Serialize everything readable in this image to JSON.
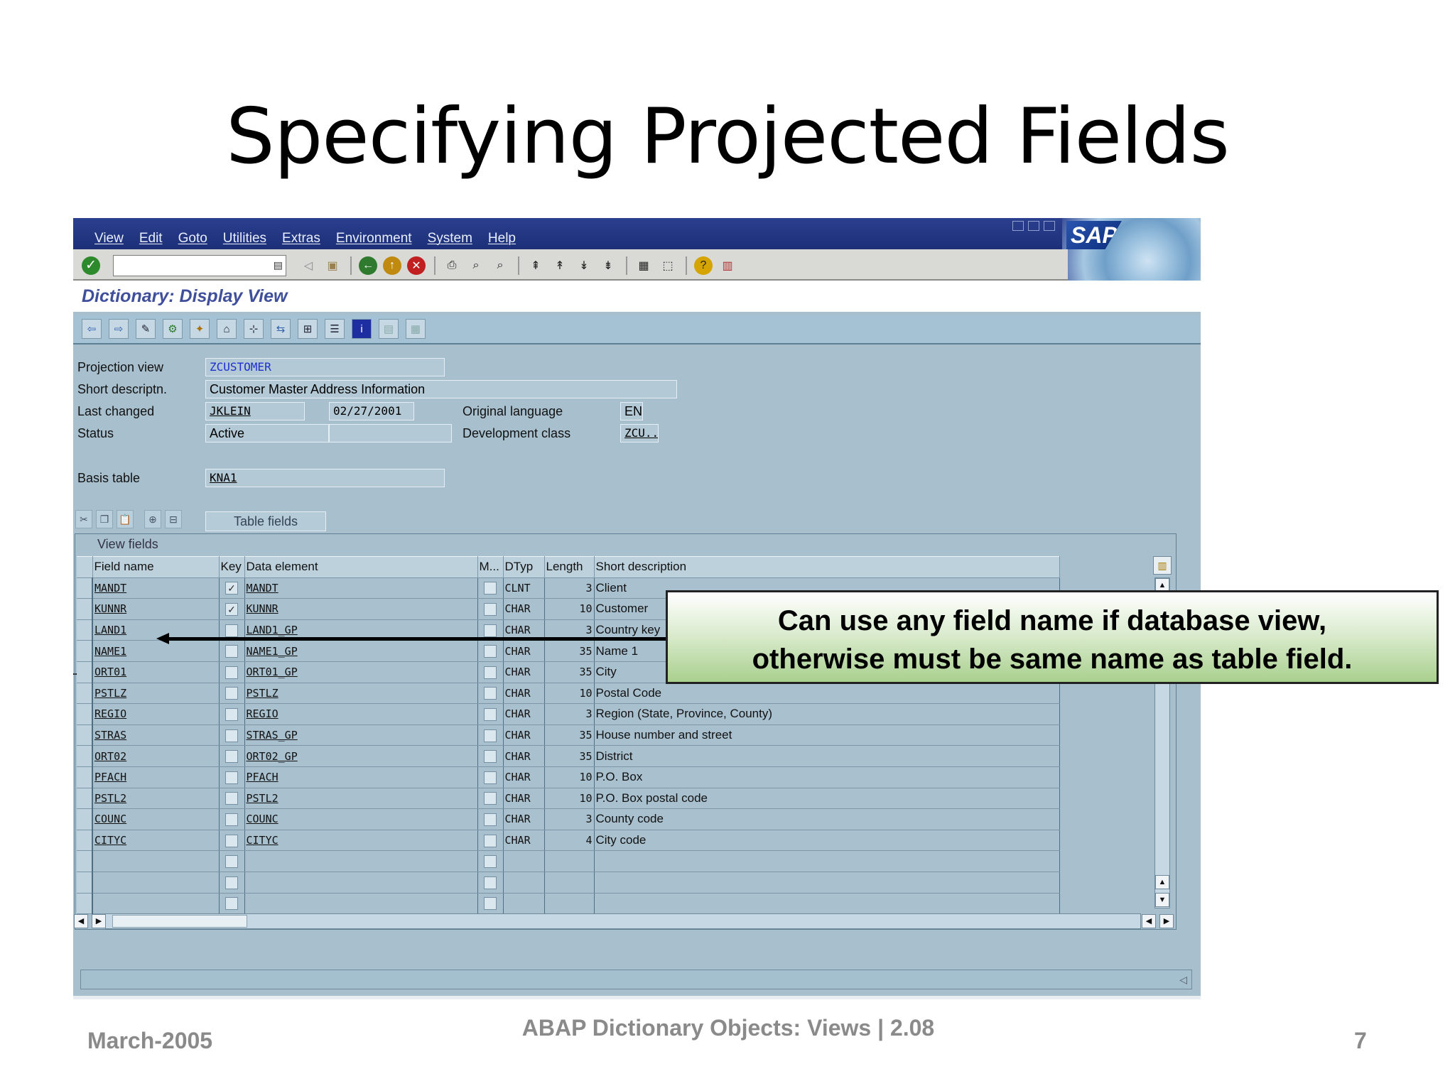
{
  "slide": {
    "title": "Specifying Projected Fields",
    "footer_left": "March-2005",
    "footer_center": "ABAP Dictionary Objects:  Views | 2.08",
    "page_number": "7"
  },
  "menu": [
    "View",
    "Edit",
    "Goto",
    "Utilities",
    "Extras",
    "Environment",
    "System",
    "Help"
  ],
  "sap_logo": "SAP",
  "screen_title": "Dictionary: Display View",
  "header": {
    "projection_view_label": "Projection view",
    "projection_view_value": "ZCUSTOMER",
    "short_descr_label": "Short descriptn.",
    "short_descr_value": "Customer Master Address Information",
    "last_changed_label": "Last changed",
    "last_changed_user": "JKLEIN",
    "last_changed_date": "02/27/2001",
    "orig_lang_label": "Original language",
    "orig_lang_value": "EN",
    "status_label": "Status",
    "status_value": "Active",
    "status_extra": "",
    "dev_class_label": "Development class",
    "dev_class_value": "ZCU...",
    "basis_table_label": "Basis table",
    "basis_table_value": "KNA1"
  },
  "table_fields_button": "Table fields",
  "view_fields_title": "View fields",
  "columns": [
    "Field name",
    "Key",
    "Data element",
    "M...",
    "DTyp",
    "Length",
    "Short description"
  ],
  "rows": [
    {
      "field": "MANDT",
      "key": true,
      "element": "MANDT",
      "dtyp": "CLNT",
      "length": "3",
      "descr": "Client"
    },
    {
      "field": "KUNNR",
      "key": true,
      "element": "KUNNR",
      "dtyp": "CHAR",
      "length": "10",
      "descr": "Customer"
    },
    {
      "field": "LAND1",
      "key": false,
      "element": "LAND1_GP",
      "dtyp": "CHAR",
      "length": "3",
      "descr": "Country key"
    },
    {
      "field": "NAME1",
      "key": false,
      "element": "NAME1_GP",
      "dtyp": "CHAR",
      "length": "35",
      "descr": "Name 1"
    },
    {
      "field": "ORT01",
      "key": false,
      "element": "ORT01_GP",
      "dtyp": "CHAR",
      "length": "35",
      "descr": "City"
    },
    {
      "field": "PSTLZ",
      "key": false,
      "element": "PSTLZ",
      "dtyp": "CHAR",
      "length": "10",
      "descr": "Postal Code"
    },
    {
      "field": "REGIO",
      "key": false,
      "element": "REGIO",
      "dtyp": "CHAR",
      "length": "3",
      "descr": "Region (State, Province, County)"
    },
    {
      "field": "STRAS",
      "key": false,
      "element": "STRAS_GP",
      "dtyp": "CHAR",
      "length": "35",
      "descr": "House number and street"
    },
    {
      "field": "ORT02",
      "key": false,
      "element": "ORT02_GP",
      "dtyp": "CHAR",
      "length": "35",
      "descr": "District"
    },
    {
      "field": "PFACH",
      "key": false,
      "element": "PFACH",
      "dtyp": "CHAR",
      "length": "10",
      "descr": "P.O. Box"
    },
    {
      "field": "PSTL2",
      "key": false,
      "element": "PSTL2",
      "dtyp": "CHAR",
      "length": "10",
      "descr": "P.O. Box postal code"
    },
    {
      "field": "COUNC",
      "key": false,
      "element": "COUNC",
      "dtyp": "CHAR",
      "length": "3",
      "descr": "County code"
    },
    {
      "field": "CITYC",
      "key": false,
      "element": "CITYC",
      "dtyp": "CHAR",
      "length": "4",
      "descr": "City code"
    }
  ],
  "empty_rows": 3,
  "callout": {
    "line1": "Can use any field name if database view,",
    "line2": "otherwise must be same name as table field."
  },
  "colors": {
    "menubar": "#2a3f8f",
    "screen_bg": "#a8c0ce",
    "title_blue": "#3f4f9b",
    "callout_green": "#a9d08e"
  }
}
